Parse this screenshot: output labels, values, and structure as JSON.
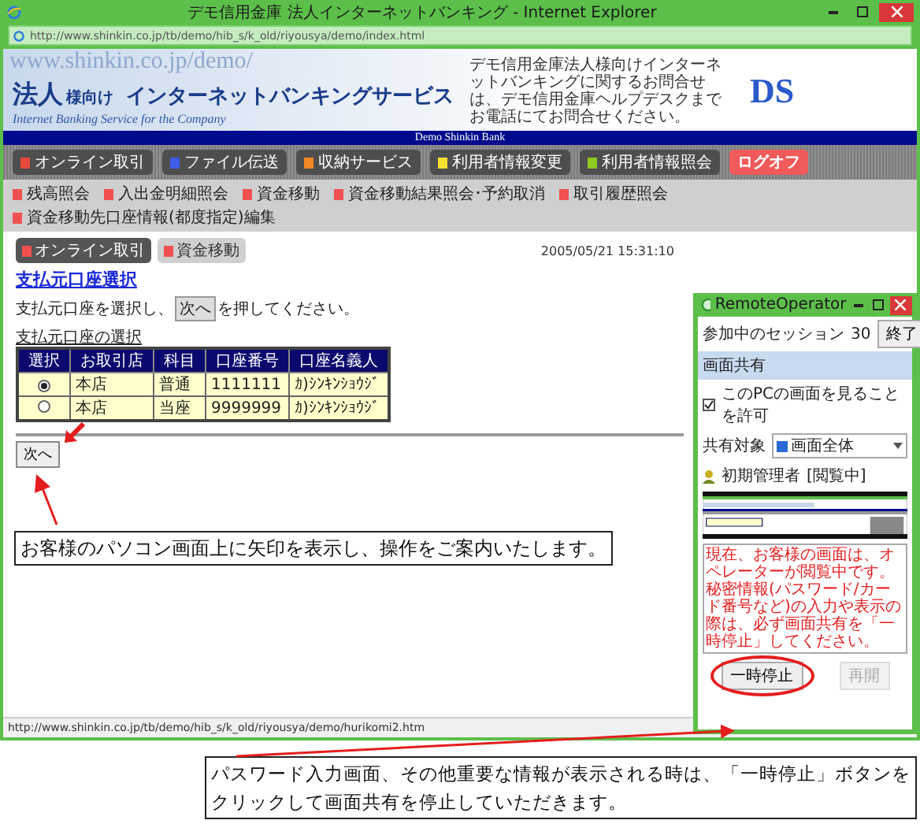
{
  "browser": {
    "title": "デモ信用金庫 法人インターネットバンキング - Internet Explorer",
    "address": "http://www.shinkin.co.jp/tb/demo/hib_s/k_old/riyousya/demo/index.html",
    "status_url": "http://www.shinkin.co.jp/tb/demo/hib_s/k_old/riyousya/demo/hurikomi2.htm"
  },
  "site_header": {
    "background_text": "www.shinkin.co.jp/demo/",
    "title_main": "法人",
    "title_small": "様向け",
    "title_rest": "インターネットバンキングサービス",
    "subtitle": "Internet Banking Service for the Company",
    "contact_note": "デモ信用金庫法人様向けインターネットバンキングに関するお問合せは、デモ信用金庫ヘルプデスクまでお電話にてお問合せください。",
    "logo": "DS",
    "bank_name": "Demo Shinkin Bank"
  },
  "main_menu": [
    {
      "label": "オンライン取引",
      "kind": "menu",
      "color": "#e8483c"
    },
    {
      "label": "ファイル伝送",
      "kind": "menu",
      "color": "#3c5ce8"
    },
    {
      "label": "収納サービス",
      "kind": "menu",
      "color": "#f08a24"
    },
    {
      "label": "利用者情報変更",
      "kind": "menu",
      "color": "#f4e030"
    },
    {
      "label": "利用者情報照会",
      "kind": "menu",
      "color": "#8cc820"
    },
    {
      "label": "ログオフ",
      "kind": "logoff",
      "color": "#f05a5a"
    }
  ],
  "sub_menu": [
    "残高照会",
    "入出金明細照会",
    "資金移動",
    "資金移動結果照会･予約取消",
    "取引履歴照会",
    "資金移動先口座情報(都度指定)編集"
  ],
  "breadcrumb": [
    {
      "label": "オンライン取引",
      "selected": true
    },
    {
      "label": "資金移動",
      "selected": false
    }
  ],
  "timestamp": "2005/05/21 15:31:10",
  "page": {
    "heading": "支払元口座選択",
    "instruction_before": "支払元口座を選択し、",
    "instruction_button": "次へ",
    "instruction_after": "を押してください。",
    "table_caption": "支払元口座の選択"
  },
  "table": {
    "columns": [
      "選択",
      "お取引店",
      "科目",
      "口座番号",
      "口座名義人"
    ],
    "rows": [
      {
        "selected": true,
        "cells": [
          "",
          "本店",
          "普通",
          "1111111",
          "ｶ)ｼﾝｷﾝｼｮｳｼﾞ"
        ]
      },
      {
        "selected": false,
        "cells": [
          "",
          "本店",
          "当座",
          "9999999",
          "ｶ)ｼﾝｷﾝｼｮｳｼﾞ"
        ]
      }
    ]
  },
  "next_button": "次へ",
  "remote_operator": {
    "title": "RemoteOperator",
    "session_label": "参加中のセッション",
    "session_count": "30",
    "end_button": "終了",
    "section": "画面共有",
    "allow_view": {
      "label": "このPCの画面を見ることを許可",
      "checked": true
    },
    "share_target_label": "共有対象",
    "share_target": "画面全体",
    "viewer": {
      "name": "初期管理者",
      "status": "[閲覧中]"
    },
    "message": [
      "現在、お客様の画面は、オペレーターが閲覧中です。",
      "秘密情報(パスワード/カード番号など)の入力や表示の際は、必ず画面共有を「一時停止」してください。"
    ],
    "buttons": [
      {
        "label": "一時停止",
        "disabled": false,
        "highlighted": true
      },
      {
        "label": "再開",
        "disabled": true,
        "highlighted": false
      }
    ]
  },
  "callouts": [
    "お客様のパソコン画面上に矢印を表示し、操作をご案内いたします。",
    "パスワード入力画面、その他重要な情報が表示される時は、「一時停止」ボタンをクリックして画面共有を停止していただきます。"
  ]
}
